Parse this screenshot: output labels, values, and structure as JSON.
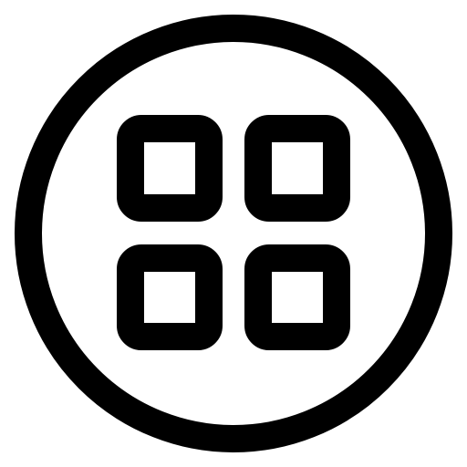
{
  "icon": {
    "name": "grid-circle-icon",
    "stroke_color": "#000000",
    "background_color": "#ffffff",
    "tiles": [
      "top-left",
      "top-right",
      "bottom-left",
      "bottom-right"
    ]
  }
}
